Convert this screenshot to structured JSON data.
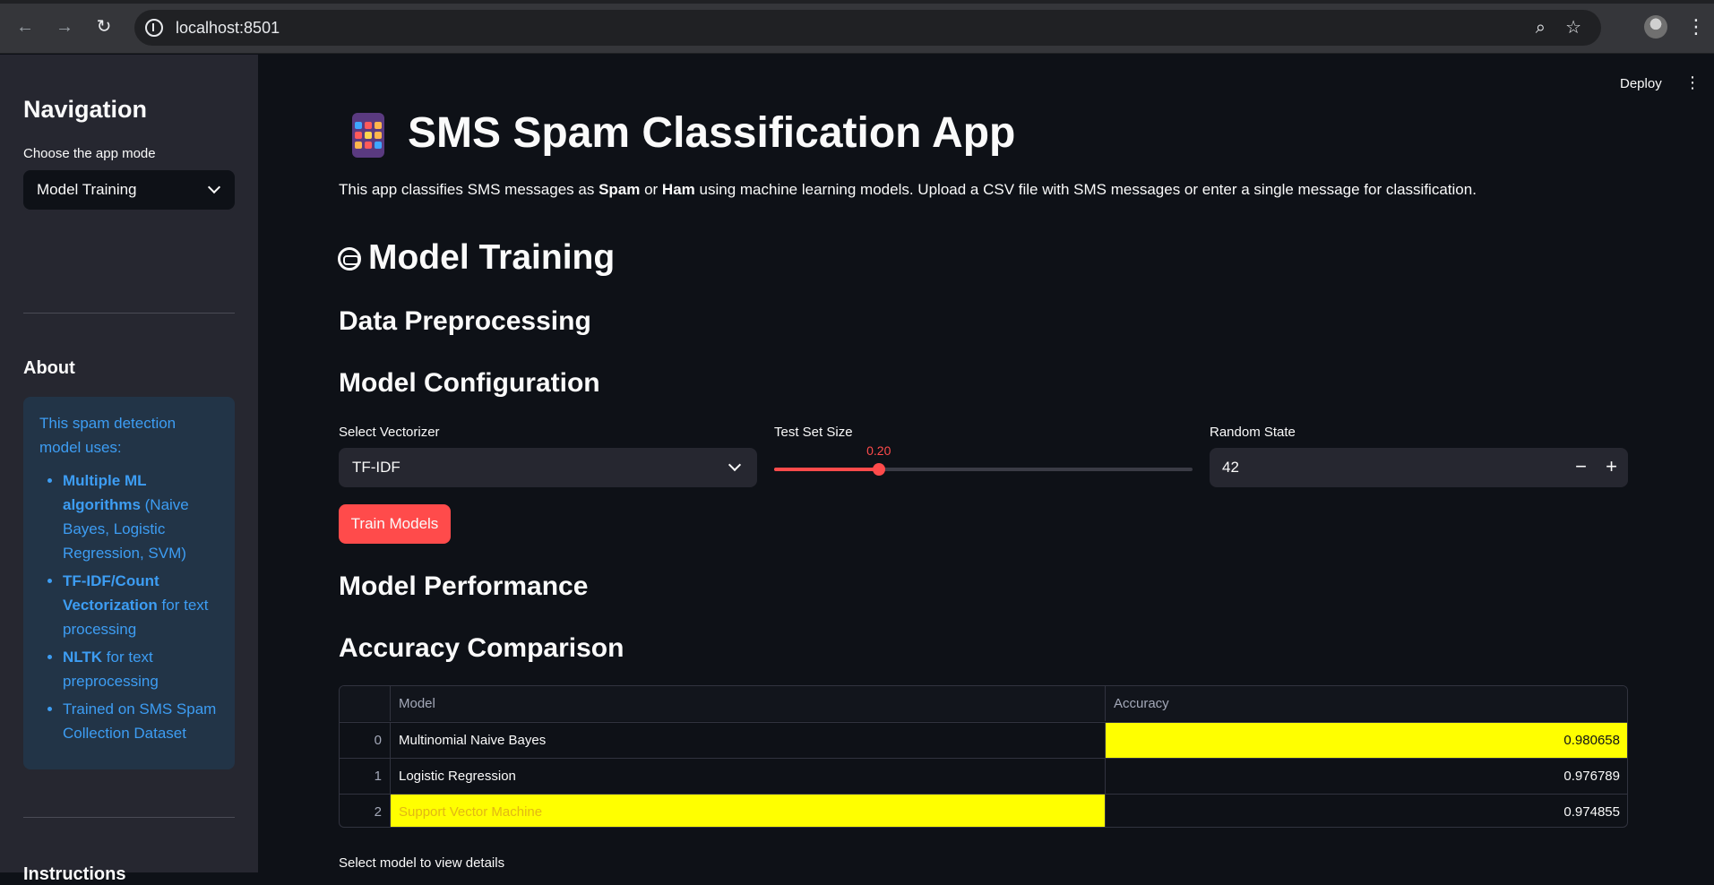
{
  "browser": {
    "url": "localhost:8501"
  },
  "header": {
    "deploy_label": "Deploy"
  },
  "sidebar": {
    "title": "Navigation",
    "mode_label": "Choose the app mode",
    "mode_value": "Model Training",
    "about_title": "About",
    "about_intro": "This spam detection model uses:",
    "about_items": [
      {
        "bold": "Multiple ML algorithms",
        "rest": " (Naive Bayes, Logistic Regression, SVM)"
      },
      {
        "bold": "TF-IDF/Count Vectorization",
        "rest": " for text processing"
      },
      {
        "bold": "NLTK",
        "rest": " for text preprocessing"
      },
      {
        "bold": "",
        "rest": "Trained on SMS Spam Collection Dataset"
      }
    ],
    "instructions_title": "Instructions"
  },
  "main": {
    "title": "SMS Spam Classification App",
    "description": {
      "part1": "This app classifies SMS messages as ",
      "spam": "Spam",
      "part2": " or ",
      "ham": "Ham",
      "part3": " using machine learning models. Upload a CSV file with SMS messages or enter a single message for classification."
    },
    "section_title": "Model Training",
    "data_preprocessing": "Data Preprocessing",
    "model_configuration": "Model Configuration",
    "vectorizer_label": "Select Vectorizer",
    "vectorizer_value": "TF-IDF",
    "test_size_label": "Test Set Size",
    "test_size_value": "0.20",
    "test_size_fraction": 0.25,
    "random_state_label": "Random State",
    "random_state_value": "42",
    "minus_label": "−",
    "plus_label": "+",
    "train_button": "Train Models",
    "model_performance": "Model Performance",
    "accuracy_comparison": "Accuracy Comparison",
    "table": {
      "columns": [
        "Model",
        "Accuracy"
      ],
      "rows": [
        {
          "index": "0",
          "model": "Multinomial Naive Bayes",
          "accuracy": "0.980658"
        },
        {
          "index": "1",
          "model": "Logistic Regression",
          "accuracy": "0.976789"
        },
        {
          "index": "2",
          "model": "Support Vector Machine",
          "accuracy": "0.974855"
        }
      ]
    },
    "select_model_label": "Select model to view details"
  },
  "colors": {
    "primary": "#ff4b4b",
    "highlight": "#ffff00",
    "info_bg": "#223447",
    "info_text": "#3d9df3"
  }
}
